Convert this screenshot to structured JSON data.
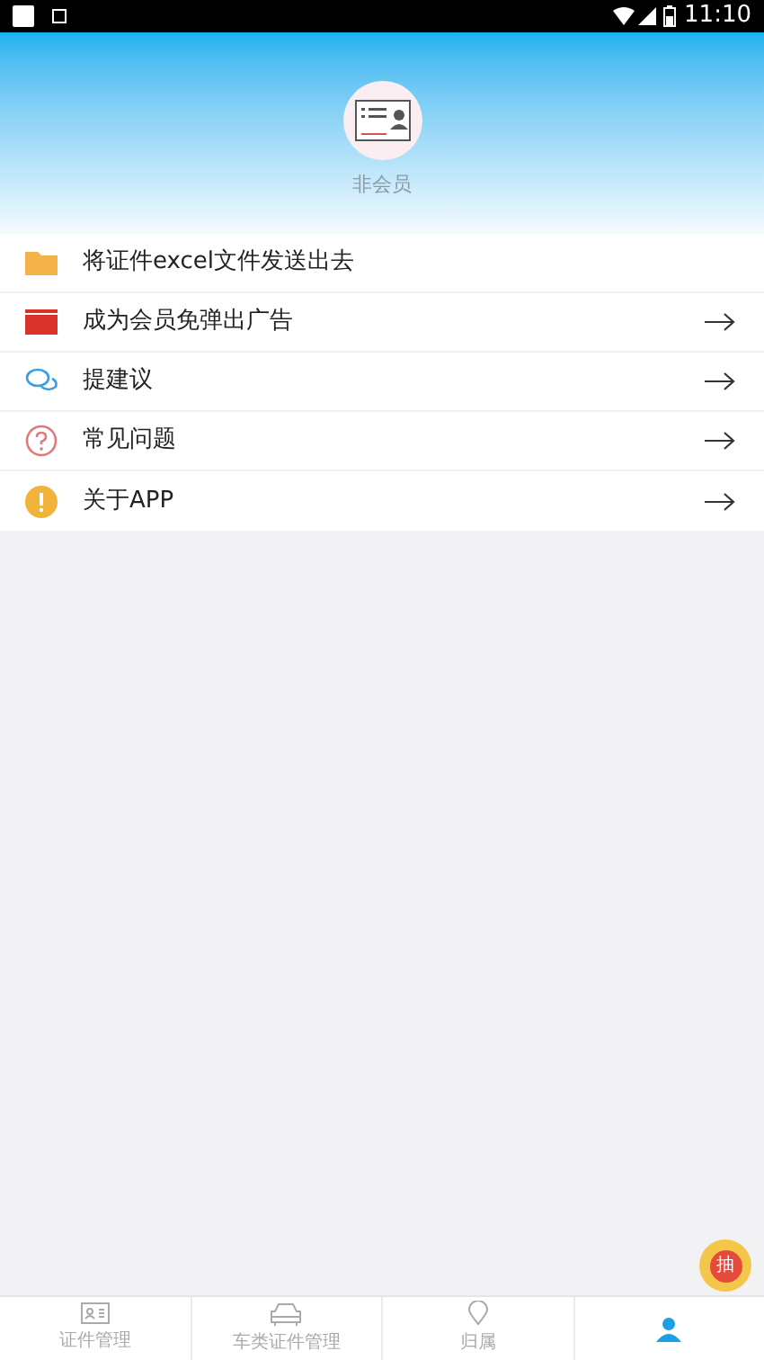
{
  "status_bar": {
    "time": "11:10"
  },
  "profile": {
    "membership": "非会员"
  },
  "menu": [
    {
      "kind": "folder",
      "label": "将证件excel文件发送出去",
      "arrow": false
    },
    {
      "kind": "vip",
      "label": "成为会员免弹出广告",
      "arrow": true
    },
    {
      "kind": "chat",
      "label": "提建议",
      "arrow": true
    },
    {
      "kind": "question",
      "label": "常见问题",
      "arrow": true
    },
    {
      "kind": "info",
      "label": "关于APP",
      "arrow": true
    }
  ],
  "floating_button": {
    "label": "抽"
  },
  "tabs": [
    {
      "kind": "card",
      "label": "证件管理",
      "selected": false
    },
    {
      "kind": "car",
      "label": "车类证件管理",
      "selected": false
    },
    {
      "kind": "place",
      "label": "归属",
      "selected": false
    },
    {
      "kind": "person",
      "selected": true
    }
  ]
}
